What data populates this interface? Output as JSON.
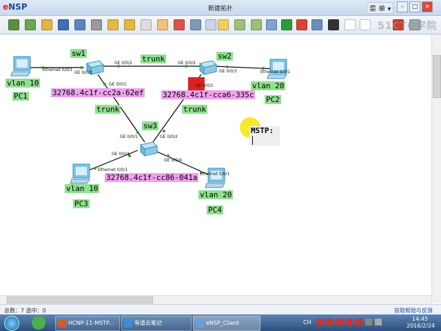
{
  "window": {
    "app_name_prefix": "e",
    "app_name_rest": "NSP",
    "title": "新建拓扑",
    "menu_label": "菜 单 ▾",
    "minimize": "–",
    "maximize": "□",
    "close": "×"
  },
  "toolbar": {
    "watermark": "51CTO学院",
    "icons": [
      "new-topology-icon",
      "new-label-icon",
      "open-icon",
      "save-icon",
      "save-as-icon",
      "print-icon",
      "undo-icon",
      "redo-icon",
      "select-icon",
      "drag-icon",
      "delete-icon",
      "delete-link-icon",
      "text-icon",
      "rectangle-icon",
      "zoom-in-icon",
      "zoom-out-icon",
      "fit-icon",
      "start-icon",
      "stop-icon",
      "capture-icon",
      "cli-icon",
      "topology-icon",
      "huawei-icon",
      "settings-icon",
      "help-icon"
    ]
  },
  "topology": {
    "devices": {
      "sw1": "sw1",
      "sw2": "sw2",
      "sw3": "sw3",
      "pc1": "PC1",
      "pc2": "PC2",
      "pc3": "PC3",
      "pc4": "PC4"
    },
    "labels": {
      "pc1_vlan": "vlan 10",
      "pc2_vlan": "vlan 20",
      "pc3_vlan": "vlan 10",
      "pc4_vlan": "vlan 20",
      "trunk_sw1_sw2": "trunk",
      "trunk_sw1_sw3": "trunk",
      "trunk_sw2_sw3": "trunk",
      "sw1_bridge_id": "32768.4c1f-cc2a-62ef",
      "sw2_bridge_id": "32768.4c1f-cca6-335c",
      "sw3_bridge_id": "32768.4c1f-cc86-041a",
      "mstp_note": "MSTP:"
    },
    "ports": {
      "pc1_eth": "Ethernet 0/0/1",
      "sw1_g003": "GE 0/0/3",
      "sw1_g002": "GE 0/0/2",
      "sw1_g001": "GE 0/0/1",
      "sw2_g002": "GE 0/0/2",
      "sw2_g003": "GE 0/0/3",
      "sw2_g001": "GE 0/0/1",
      "pc2_eth": "Ethernet 0/0/1",
      "sw3_g001": "GE 0/0/1",
      "sw3_g002": "GE 0/0/2",
      "sw3_g003": "GE 0/0/3",
      "sw3_g004": "GE 0/0/4",
      "pc3_eth": "Ethernet 0/0/1",
      "pc4_eth": "Ethernet 0/0/1"
    }
  },
  "statusbar": {
    "left": "总数：7  选中：0",
    "right": "获取帮助与反馈"
  },
  "taskbar": {
    "items": [
      "HCNP-11-MSTP...",
      "有道云笔记",
      "eNSP_Client"
    ],
    "ime": "CH",
    "time": "14:45",
    "date": "2016/2/24"
  },
  "colors": {
    "label_green": "#8fe08f",
    "label_pink": "#f0a0f0",
    "link_line": "#000000",
    "root_marker": "#e02020",
    "cursor_highlight": "#f5e600"
  }
}
